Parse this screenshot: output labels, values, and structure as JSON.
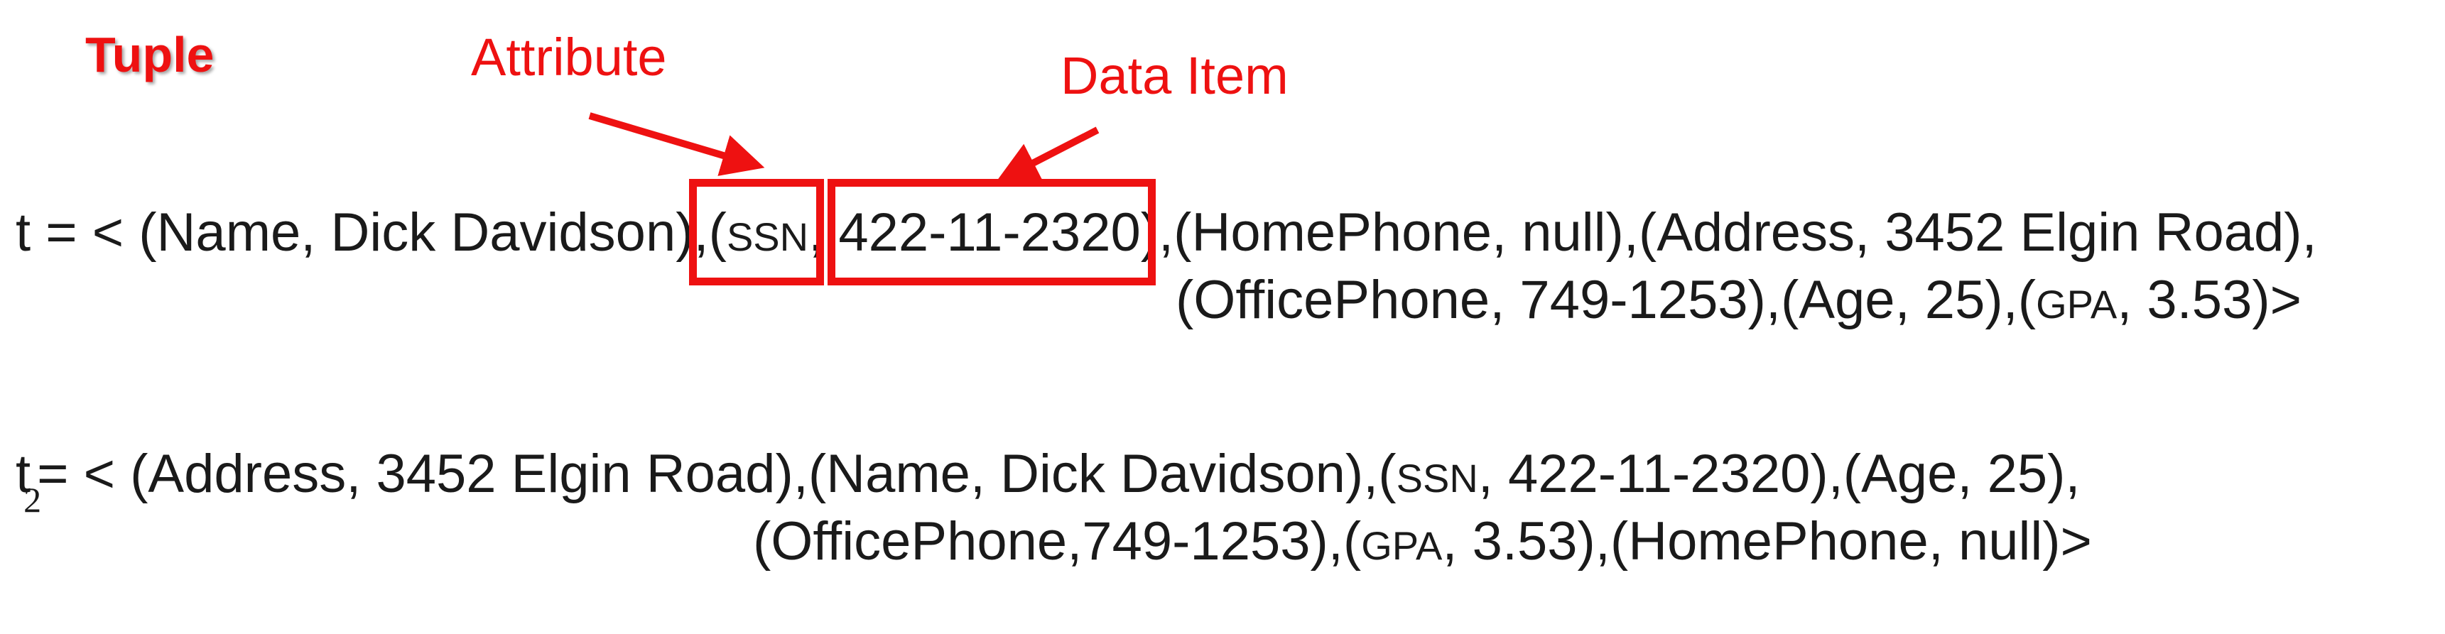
{
  "labels": {
    "tuple": "Tuple",
    "attribute": "Attribute",
    "data_item": "Data Item"
  },
  "tuple1": {
    "line1": {
      "prefix": "t = < (Name, Dick Davidson),(",
      "ssn": "SSN",
      "sep": ", ",
      "ssn_value": "422-11-2320",
      "suffix": "),(HomePhone, null),(Address, 3452 Elgin Road),"
    },
    "line2": {
      "prefix": "(OfficePhone, 749-1253),(Age, 25),(",
      "gpa": "GPA",
      "suffix": ", 3.53)>"
    }
  },
  "tuple2": {
    "line1": {
      "t": "t",
      "subscript": "2",
      "prefix": "= < (Address, 3452 Elgin Road),(Name, Dick Davidson),(",
      "ssn": "SSN",
      "suffix": ", 422-11-2320),(Age, 25),"
    },
    "line2": {
      "prefix": "(OfficePhone,749-1253),(",
      "gpa": "GPA",
      "suffix": ", 3.53),(HomePhone, null)>"
    }
  },
  "colors": {
    "annotation": "#ee1111",
    "text": "#1a1a1a",
    "background": "#ffffff"
  }
}
